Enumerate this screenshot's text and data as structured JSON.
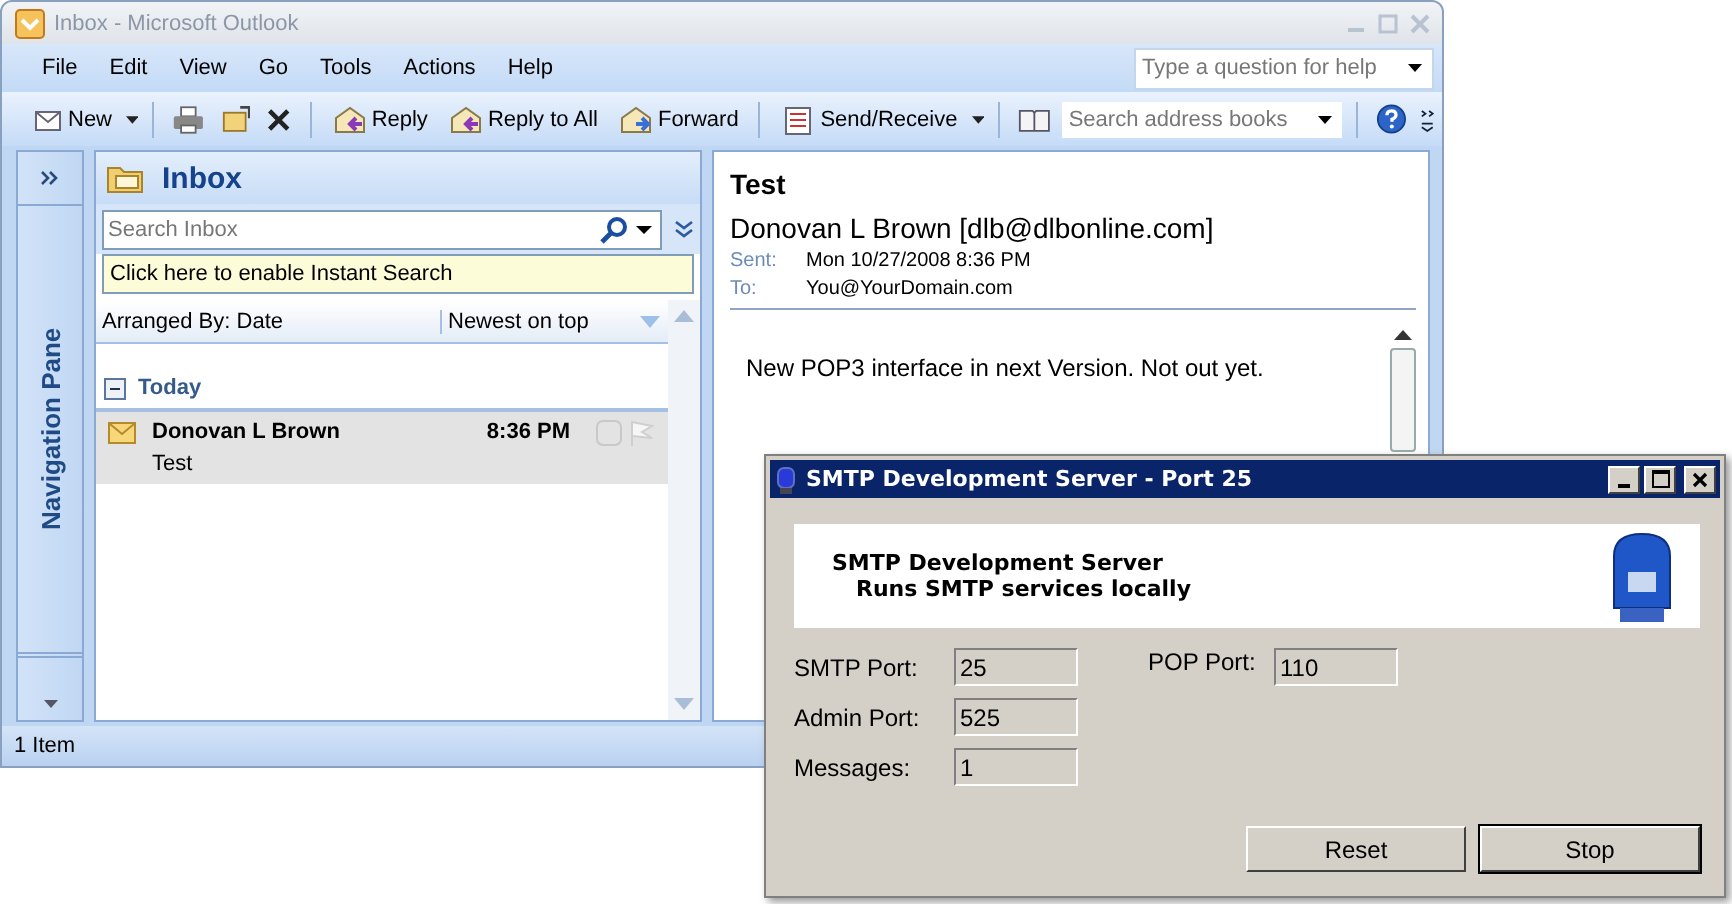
{
  "window": {
    "title": "Inbox - Microsoft Outlook"
  },
  "menu": [
    "File",
    "Edit",
    "View",
    "Go",
    "Tools",
    "Actions",
    "Help"
  ],
  "help_box": {
    "placeholder": "Type a question for help"
  },
  "toolbar": [
    {
      "kind": "new",
      "label": "New"
    },
    {
      "kind": "print"
    },
    {
      "kind": "move"
    },
    {
      "kind": "delete"
    },
    {
      "kind": "reply",
      "label": "Reply"
    },
    {
      "kind": "reply_all",
      "label": "Reply to All"
    },
    {
      "kind": "forward",
      "label": "Forward"
    },
    {
      "kind": "send_receive",
      "label": "Send/Receive"
    }
  ],
  "address_search": {
    "placeholder": "Search address books"
  },
  "navigation_pane": {
    "label": "Navigation Pane"
  },
  "inbox": {
    "title": "Inbox",
    "search": {
      "placeholder": "Search Inbox"
    },
    "instant_search": "Click here to enable Instant Search",
    "arranged_by": "Arranged By: Date",
    "sort": "Newest on top",
    "group": "Today",
    "messages": [
      {
        "sender": "Donovan L Brown",
        "time": "8:36 PM",
        "subject": "Test",
        "selected": true
      }
    ]
  },
  "reading_pane": {
    "subject": "Test",
    "from": "Donovan L Brown [dlb@dlbonline.com]",
    "sent_label": "Sent:",
    "sent": "Mon 10/27/2008 8:36 PM",
    "to_label": "To:",
    "to": "You@YourDomain.com",
    "body": "New POP3 interface in next Version.  Not out yet."
  },
  "status_bar": "1 Item",
  "dialog": {
    "title": "SMTP Development Server - Port 25",
    "heading": "SMTP Development Server",
    "subheading": "Runs SMTP services locally",
    "fields": [
      {
        "label": "SMTP Port:",
        "value": "25"
      },
      {
        "label": "POP Port:",
        "value": "110"
      },
      {
        "label": "Admin Port:",
        "value": "525"
      },
      {
        "label": "Messages:",
        "value": "1"
      }
    ],
    "buttons": [
      {
        "label": "Reset",
        "default": false
      },
      {
        "label": "Stop",
        "default": true
      }
    ]
  }
}
